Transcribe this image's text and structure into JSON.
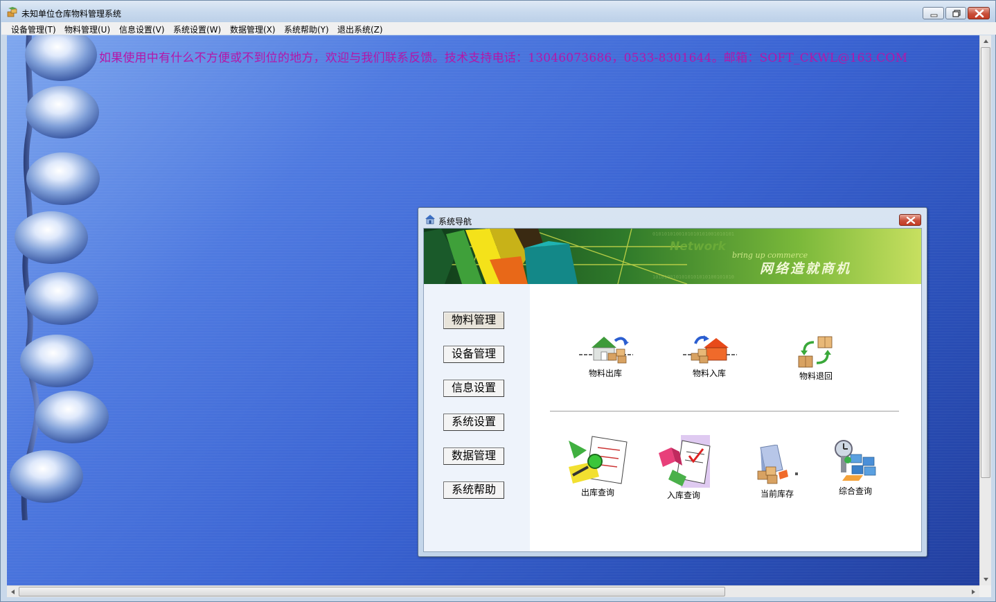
{
  "window": {
    "title": "未知单位仓库物料管理系统"
  },
  "menu": [
    {
      "label": "设备管理(T)"
    },
    {
      "label": "物料管理(U)"
    },
    {
      "label": "信息设置(V)"
    },
    {
      "label": "系统设置(W)"
    },
    {
      "label": "数据管理(X)"
    },
    {
      "label": "系统帮助(Y)"
    },
    {
      "label": "退出系统(Z)"
    }
  ],
  "notice": {
    "text": "如果使用中有什么不方便或不到位的地方，欢迎与我们联系反馈。技术支持电话：13046073686，0533-8301644。邮箱：SOFT_CKWL@163.COM"
  },
  "nav": {
    "title": "系统导航",
    "banner": {
      "line1": "Network",
      "line2": "bring up commerce",
      "line3": "网络造就商机"
    },
    "sidebar": [
      {
        "label": "物料管理"
      },
      {
        "label": "设备管理"
      },
      {
        "label": "信息设置"
      },
      {
        "label": "系统设置"
      },
      {
        "label": "数据管理"
      },
      {
        "label": "系统帮助"
      }
    ],
    "tools_top": [
      {
        "label": "物料出库",
        "icon": "material-out-icon"
      },
      {
        "label": "物料入库",
        "icon": "material-in-icon"
      },
      {
        "label": "物料退回",
        "icon": "material-return-icon"
      }
    ],
    "tools_bottom": [
      {
        "label": "出库查询",
        "icon": "out-query-icon"
      },
      {
        "label": "入库查询",
        "icon": "in-query-icon"
      },
      {
        "label": "当前库存",
        "icon": "current-stock-icon"
      },
      {
        "label": "综合查询",
        "icon": "overall-query-icon"
      }
    ]
  },
  "colors": {
    "notice_text": "#b416a8",
    "desktop_blue": "#3a63d2",
    "close_red": "#c9503a"
  }
}
